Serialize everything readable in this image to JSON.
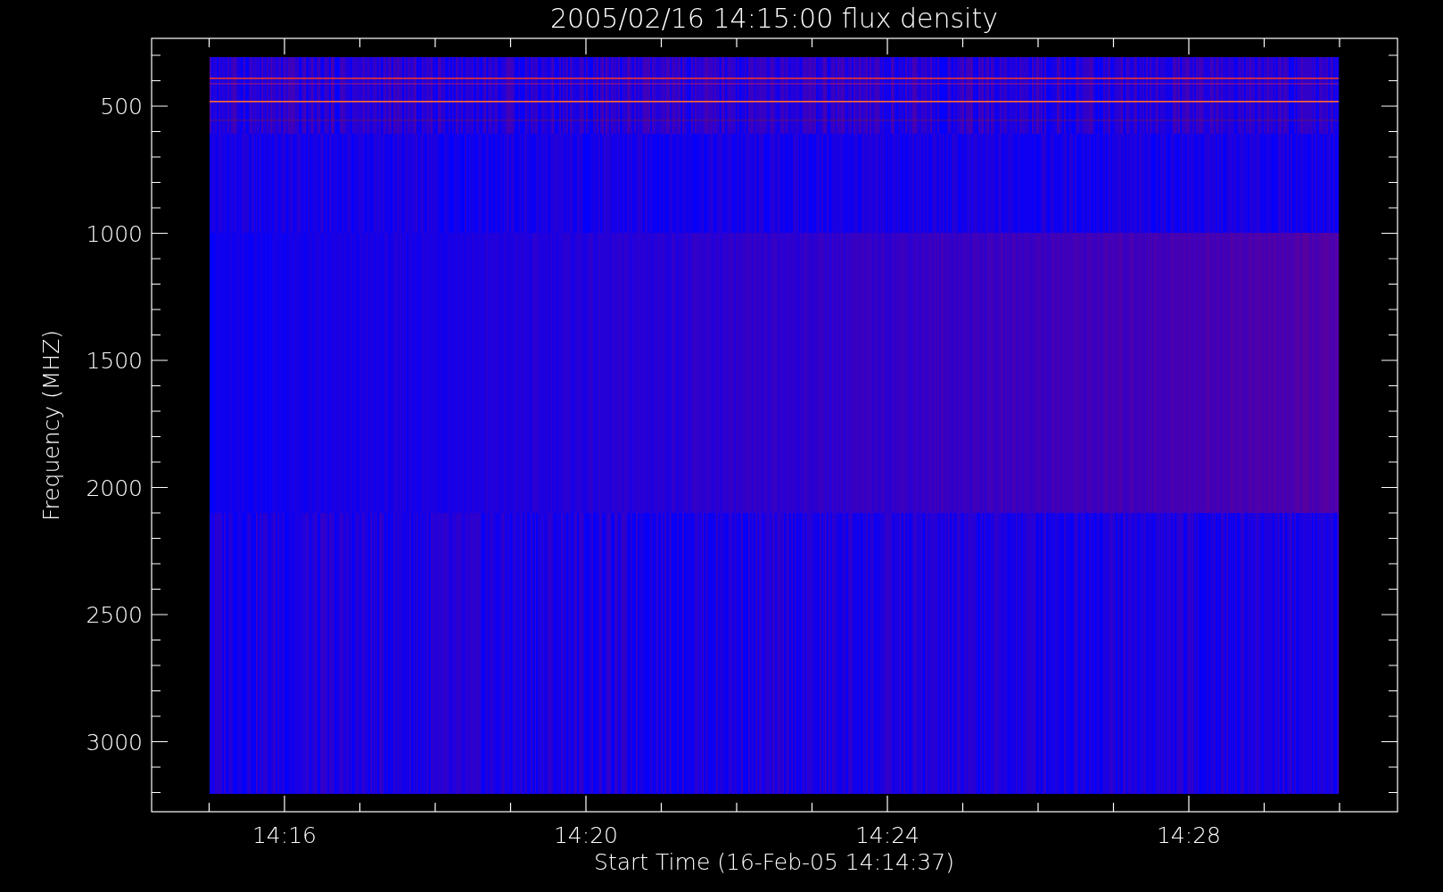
{
  "plot": {
    "title": "2005/02/16 14:15:00 flux density",
    "y_axis": {
      "label": "Frequency (MHZ)",
      "ticks": [
        "500",
        "1000",
        "1500",
        "2000",
        "2500",
        "3000"
      ]
    },
    "x_axis": {
      "label": "Start Time (16-Feb-05 14:14:37)",
      "ticks": [
        "14:16",
        "14:20",
        "14:24",
        "14:28"
      ]
    }
  }
}
